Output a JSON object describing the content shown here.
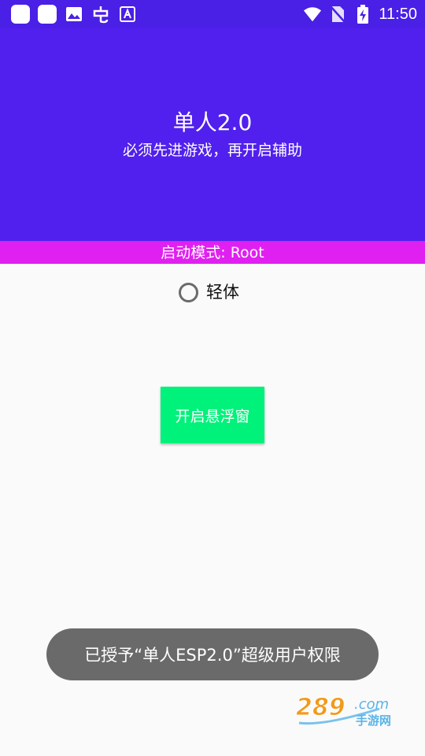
{
  "status_bar": {
    "time": "11:50",
    "left_icons": [
      "app-square-icon",
      "app-square-icon",
      "image-icon",
      "bug-icon",
      "font-icon"
    ],
    "right_icons": [
      "wifi-icon",
      "no-sim-icon",
      "battery-charging-icon"
    ]
  },
  "header": {
    "title": "单人2.0",
    "subtitle": "必须先进游戏，再开启辅助",
    "background": "#5120ee"
  },
  "mode_bar": {
    "text": "启动模式: Root",
    "background": "#e020f0"
  },
  "option": {
    "label": "轻体",
    "checked": false
  },
  "float_button": {
    "label": "开启悬浮窗",
    "background": "#00f27a"
  },
  "toast": {
    "message": "已授予“单人ESP2.0”超级用户权限"
  },
  "watermark": {
    "number": "289",
    "domain": ".com",
    "site_name": "手游网"
  }
}
